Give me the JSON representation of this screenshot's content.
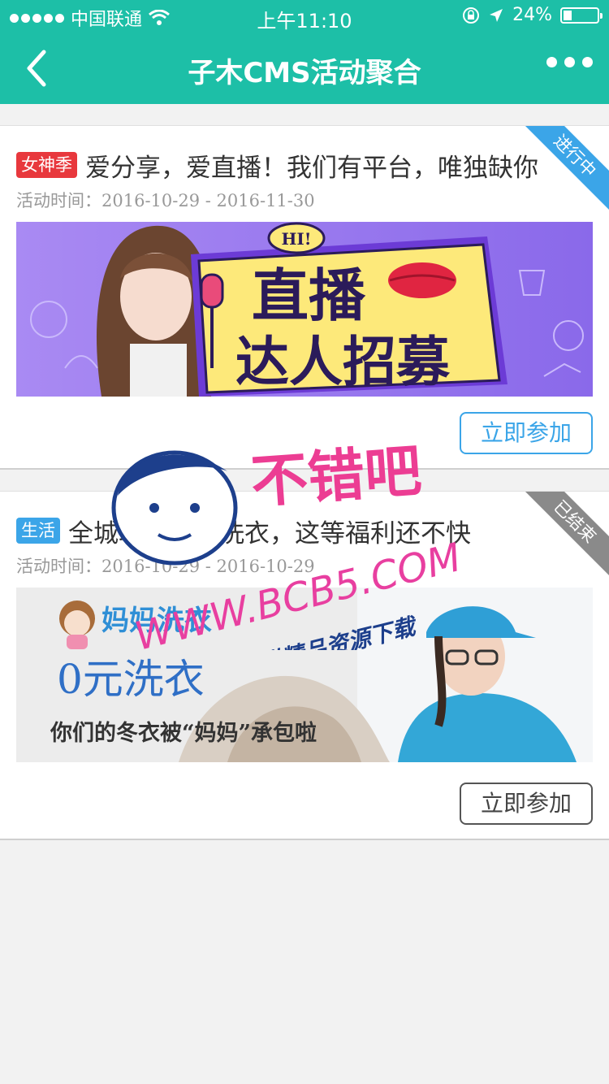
{
  "status_bar": {
    "carrier": "中国联通",
    "time": "上午11:10",
    "battery": "24%",
    "battery_level": 0.24
  },
  "navbar": {
    "title": "子木CMS活动聚合"
  },
  "activities": [
    {
      "tag": "女神季",
      "tag_color": "#e8383d",
      "title": "爱分享，爱直播！我们有平台，唯独缺你",
      "time_label": "活动时间：",
      "time_range": "2016-10-29 - 2016-11-30",
      "status": "进行中",
      "status_color": "#3ba5e8",
      "button": "立即参加",
      "banner": {
        "line1": "HI!",
        "line2": "直播",
        "line3": "达人招募"
      }
    },
    {
      "tag": "生活",
      "tag_color": "#3ba5e8",
      "title": "全城取件收送洗衣，这等福利还不快",
      "time_label": "活动时间：",
      "time_range": "2016-10-29 - 2016-10-29",
      "status": "已结束",
      "status_color": "#8a8a8a",
      "button": "立即参加",
      "banner": {
        "brand": "妈妈洗衣",
        "headline": "0元洗衣",
        "subline": "你们的冬衣被“妈妈”承包啦"
      }
    }
  ],
  "watermark": {
    "brand": "不错吧",
    "url": "WWW.BCB5.COM",
    "slogan": "免费提供精品资源下载"
  }
}
